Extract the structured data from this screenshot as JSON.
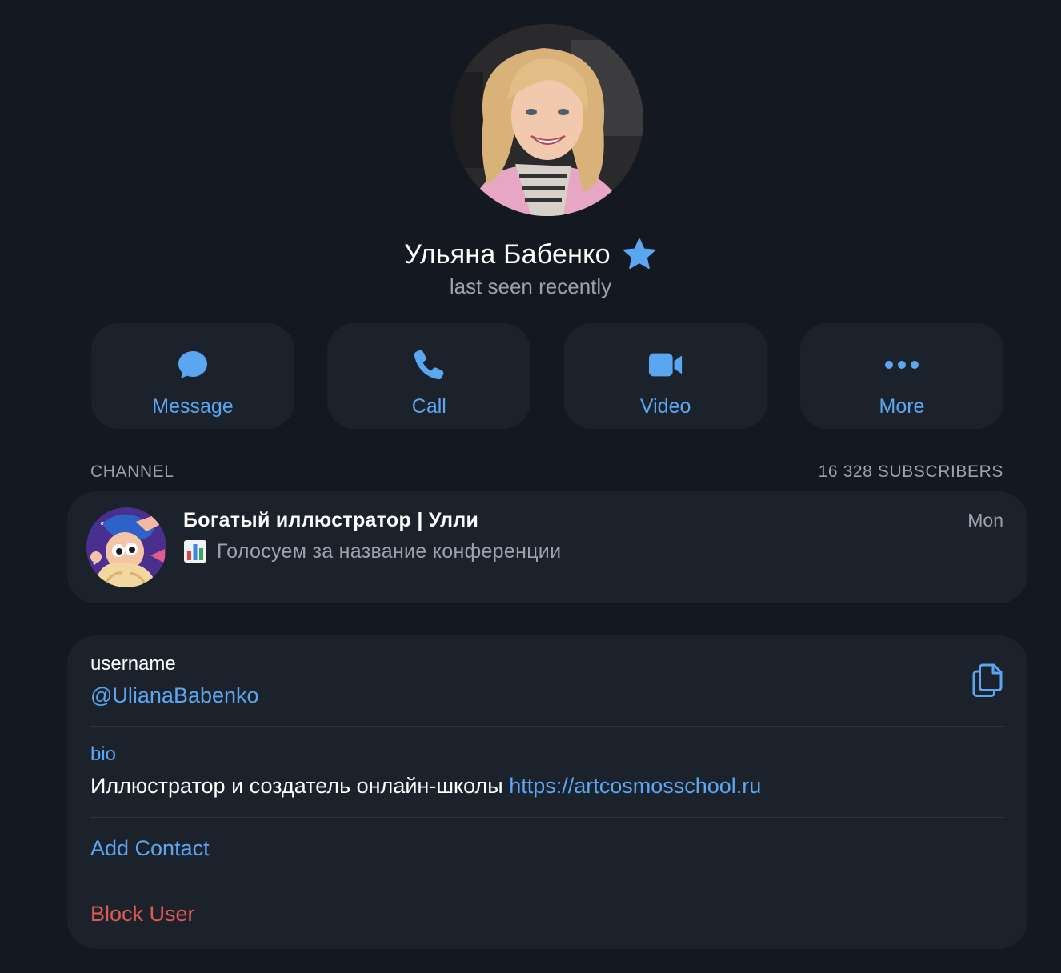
{
  "profile": {
    "name": "Ульяна Бабенко",
    "status": "last seen recently",
    "badge_icon": "premium-star-icon"
  },
  "actions": [
    {
      "label": "Message",
      "icon": "message-bubble-icon"
    },
    {
      "label": "Call",
      "icon": "phone-icon"
    },
    {
      "label": "Video",
      "icon": "video-camera-icon"
    },
    {
      "label": "More",
      "icon": "more-dots-icon"
    }
  ],
  "channel": {
    "section_label": "CHANNEL",
    "subscribers": "16 328 SUBSCRIBERS",
    "title": "Богатый иллюстратор | Улли",
    "preview": "Голосуем за название конференции",
    "preview_icon": "bar-chart-icon",
    "time": "Mon"
  },
  "info": {
    "username_label": "username",
    "username_value": "@UlianaBabenko",
    "bio_label": "bio",
    "bio_text": "Иллюстратор и создатель онлайн-школы ",
    "bio_link": "https://artcosmosschool.ru",
    "add_contact": "Add Contact",
    "block_user": "Block User"
  },
  "colors": {
    "background": "#131821",
    "card": "#1c222c",
    "accent": "#5aa6f0",
    "danger": "#e05a4f",
    "secondary_text": "#9aa3ad"
  }
}
